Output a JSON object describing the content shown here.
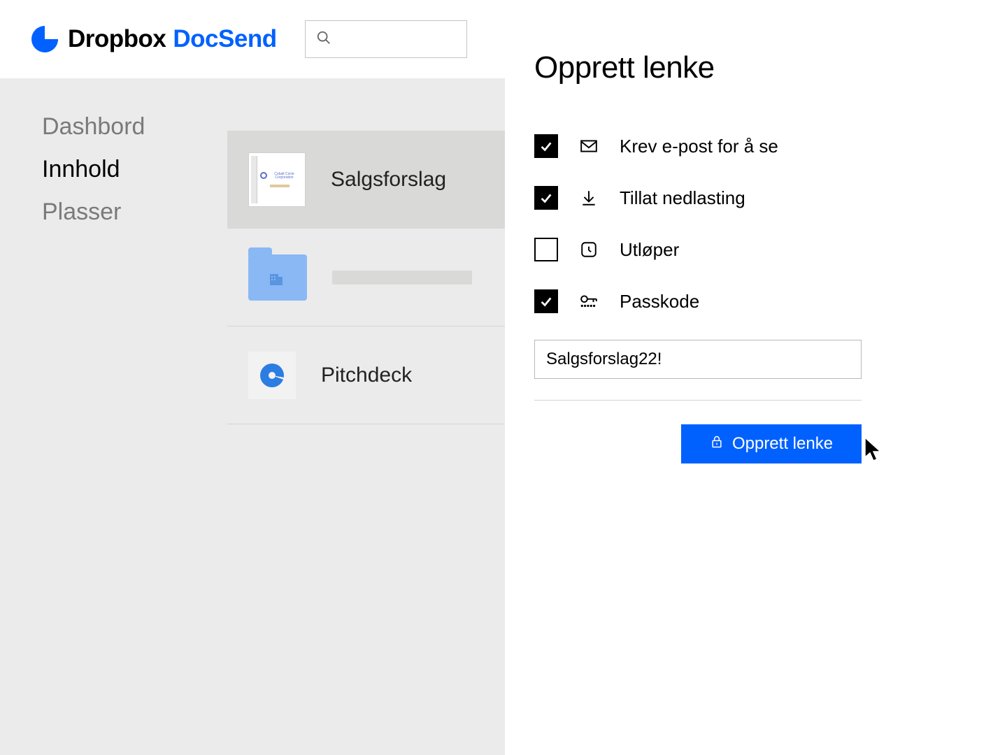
{
  "brand": {
    "primary": "Dropbox",
    "secondary": "DocSend"
  },
  "sidebar": {
    "items": [
      {
        "label": "Dashbord",
        "active": false
      },
      {
        "label": "Innhold",
        "active": true
      },
      {
        "label": "Plasser",
        "active": false
      }
    ]
  },
  "content": {
    "rows": [
      {
        "title": "Salgsforslag"
      },
      {
        "title": ""
      },
      {
        "title": "Pitchdeck"
      }
    ]
  },
  "panel": {
    "title": "Opprett lenke",
    "options": [
      {
        "label": "Krev e-post for å se",
        "checked": true
      },
      {
        "label": "Tillat nedlasting",
        "checked": true
      },
      {
        "label": "Utløper",
        "checked": false
      },
      {
        "label": "Passkode",
        "checked": true
      }
    ],
    "passcode_value": "Salgsforslag22!",
    "create_label": "Opprett lenke"
  },
  "doc_thumb": {
    "company1": "Cobalt Circle",
    "company2": "Corporation"
  }
}
